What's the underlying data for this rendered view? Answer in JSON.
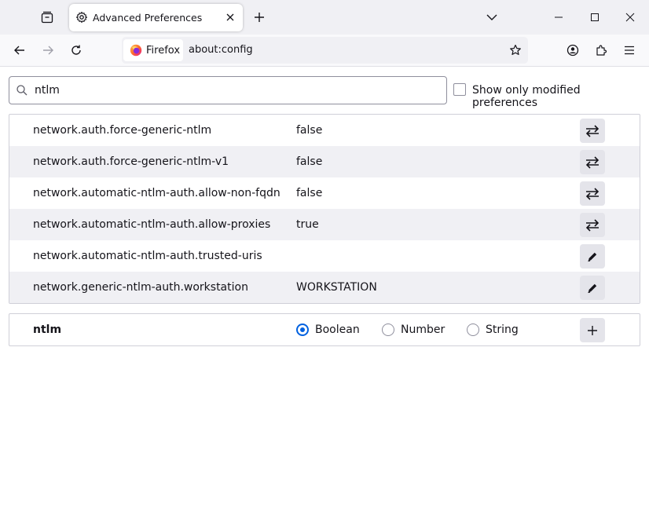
{
  "browser": {
    "tab": {
      "title": "Advanced Preferences"
    },
    "urlbar": {
      "identity_label": "Firefox",
      "url": "about:config"
    }
  },
  "search": {
    "value": "ntlm"
  },
  "show_modified": {
    "label": "Show only modified preferences",
    "checked": false
  },
  "preferences": [
    {
      "name": "network.auth.force-generic-ntlm",
      "value": "false",
      "action": "toggle"
    },
    {
      "name": "network.auth.force-generic-ntlm-v1",
      "value": "false",
      "action": "toggle"
    },
    {
      "name": "network.automatic-ntlm-auth.allow-non-fqdn",
      "value": "false",
      "action": "toggle"
    },
    {
      "name": "network.automatic-ntlm-auth.allow-proxies",
      "value": "true",
      "action": "toggle"
    },
    {
      "name": "network.automatic-ntlm-auth.trusted-uris",
      "value": "",
      "action": "edit"
    },
    {
      "name": "network.generic-ntlm-auth.workstation",
      "value": "WORKSTATION",
      "action": "edit"
    }
  ],
  "new_pref": {
    "name": "ntlm",
    "types": [
      {
        "label": "Boolean",
        "checked": true
      },
      {
        "label": "Number",
        "checked": false
      },
      {
        "label": "String",
        "checked": false
      }
    ]
  },
  "colors": {
    "accent": "#0061e0",
    "row_alt": "#f0f0f4",
    "button": "#e4e4ea"
  }
}
